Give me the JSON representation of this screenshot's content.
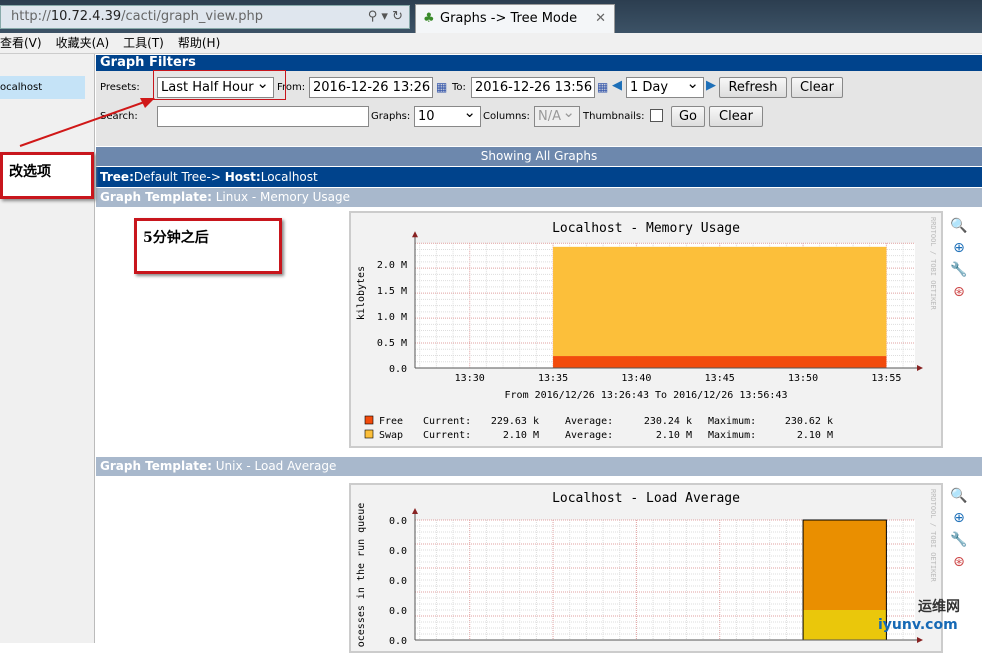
{
  "browser": {
    "url_prefix": "http://",
    "url_host": "10.72.4.39",
    "url_path": "/cacti/graph_view.php",
    "tab_title": "Graphs -> Tree Mode",
    "menu": [
      "查看(V)",
      "收藏夹(A)",
      "工具(T)",
      "帮助(H)"
    ]
  },
  "sidebar": {
    "items": [
      {
        "label": "ocalhost"
      }
    ]
  },
  "filters": {
    "title": "Graph Filters",
    "presets_label": "Presets:",
    "presets_value": "Last Half Hour",
    "from_label": "From:",
    "from_value": "2016-12-26 13:26",
    "to_label": "To:",
    "to_value": "2016-12-26 13:56",
    "timespan_value": "1 Day",
    "refresh": "Refresh",
    "clear": "Clear",
    "search_label": "Search:",
    "search_value": "",
    "search_placeholder": "",
    "graphs_label": "Graphs:",
    "graphs_value": "10",
    "columns_label": "Columns:",
    "columns_value": "N/A",
    "thumbnails_label": "Thumbnails:",
    "thumbnails_checked": false,
    "go": "Go",
    "clear2": "Clear"
  },
  "showing": "Showing All Graphs",
  "tree": {
    "tree_label": "Tree:",
    "tree_value": "Default Tree->",
    "host_label": "Host:",
    "host_value": "Localhost"
  },
  "templates": [
    {
      "label": "Graph Template:",
      "value": "Linux - Memory Usage"
    },
    {
      "label": "Graph Template:",
      "value": "Unix - Load Average"
    }
  ],
  "annotations": {
    "change_option": "改选项",
    "after_5min": "5分钟之后"
  },
  "watermark": {
    "cn": "运维网",
    "en": "iyunv.com"
  },
  "graph_icons": [
    "zoom-icon",
    "export-icon",
    "edit-icon",
    "top-icon"
  ],
  "rrd_credit": "RRDTOOL / TOBI OETIKER",
  "chart_data": [
    {
      "type": "area",
      "title": "Localhost - Memory Usage",
      "ylabel": "kilobytes",
      "xlabel": "From 2016/12/26 13:26:43 To 2016/12/26 13:56:43",
      "x_ticks": [
        "13:30",
        "13:35",
        "13:40",
        "13:45",
        "13:50",
        "13:55"
      ],
      "y_ticks": [
        "0.0",
        "0.5 M",
        "1.0 M",
        "1.5 M",
        "2.0 M"
      ],
      "ylim": [
        0,
        2.4
      ],
      "grid": true,
      "stacked": true,
      "x": [
        "13:35",
        "13:55"
      ],
      "series": [
        {
          "name": "Free",
          "color": "#f24b0c",
          "values": [
            0.23,
            0.23
          ],
          "current": "229.63 k",
          "average": "230.24 k",
          "maximum": "230.62 k"
        },
        {
          "name": "Swap",
          "color": "#fcbf3a",
          "values": [
            2.1,
            2.1
          ],
          "current": "2.10 M",
          "average": "2.10 M",
          "maximum": "2.10 M"
        }
      ],
      "legend_labels": {
        "current": "Current:",
        "average": "Average:",
        "maximum": "Maximum:"
      }
    },
    {
      "type": "area",
      "title": "Localhost - Load Average",
      "ylabel": "ocesses in the run queue",
      "y_ticks": [
        "0.0",
        "0.0",
        "0.0",
        "0.0",
        "0.0"
      ],
      "ylim": [
        0,
        0.04
      ],
      "grid": true,
      "stacked": true,
      "x": [
        "13:50",
        "13:55"
      ],
      "series": [
        {
          "color": "#eac70b",
          "values": [
            0.01,
            0.01
          ]
        },
        {
          "color": "#ea8f00",
          "values": [
            0.03,
            0.03
          ]
        }
      ]
    }
  ]
}
